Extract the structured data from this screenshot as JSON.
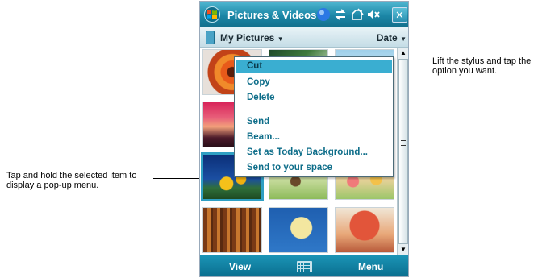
{
  "window": {
    "title": "Pictures & Videos",
    "close_label": "✕"
  },
  "header": {
    "folder_label": "My Pictures",
    "sort_label": "Date"
  },
  "context_menu": {
    "items": [
      {
        "label": "Cut",
        "highlighted": true
      },
      {
        "label": "Copy",
        "highlighted": false
      },
      {
        "label": "Delete",
        "highlighted": false
      },
      {
        "label": "Send",
        "highlighted": false
      },
      {
        "label": "Beam...",
        "highlighted": false
      },
      {
        "label": "Set as Today Background...",
        "highlighted": false
      },
      {
        "label": "Send to your space",
        "highlighted": false
      }
    ]
  },
  "softkeys": {
    "left": "View",
    "right": "Menu"
  },
  "callouts": {
    "left": "Tap and hold the selected item to display a pop-up menu.",
    "right": "Lift the stylus and tap the option you want."
  },
  "colors": {
    "title_bar": "#1b86a6",
    "menu_highlight": "#3aaed1",
    "menu_text": "#0d6d89",
    "selection_border": "#2f9fc3"
  },
  "icons": {
    "start": "windows-flag-icon",
    "status": [
      "connectivity-icon",
      "sync-icon",
      "signal-icon",
      "volume-muted-icon"
    ],
    "folder": "phone-icon",
    "keyboard": "keyboard-icon"
  }
}
